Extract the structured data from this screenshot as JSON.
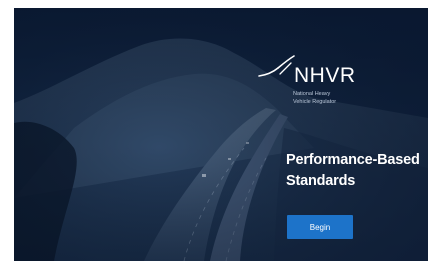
{
  "logo": {
    "name": "NHVR",
    "subtitle_line1": "National Heavy",
    "subtitle_line2": "Vehicle Regulator"
  },
  "hero": {
    "title_line1": "Performance-Based",
    "title_line2": "Standards"
  },
  "actions": {
    "begin_label": "Begin"
  },
  "colors": {
    "overlay": "#13294a",
    "button": "#1d73c9",
    "text": "#ffffff"
  },
  "icons": {
    "logo_mark": "nhvr-swoosh-icon"
  }
}
